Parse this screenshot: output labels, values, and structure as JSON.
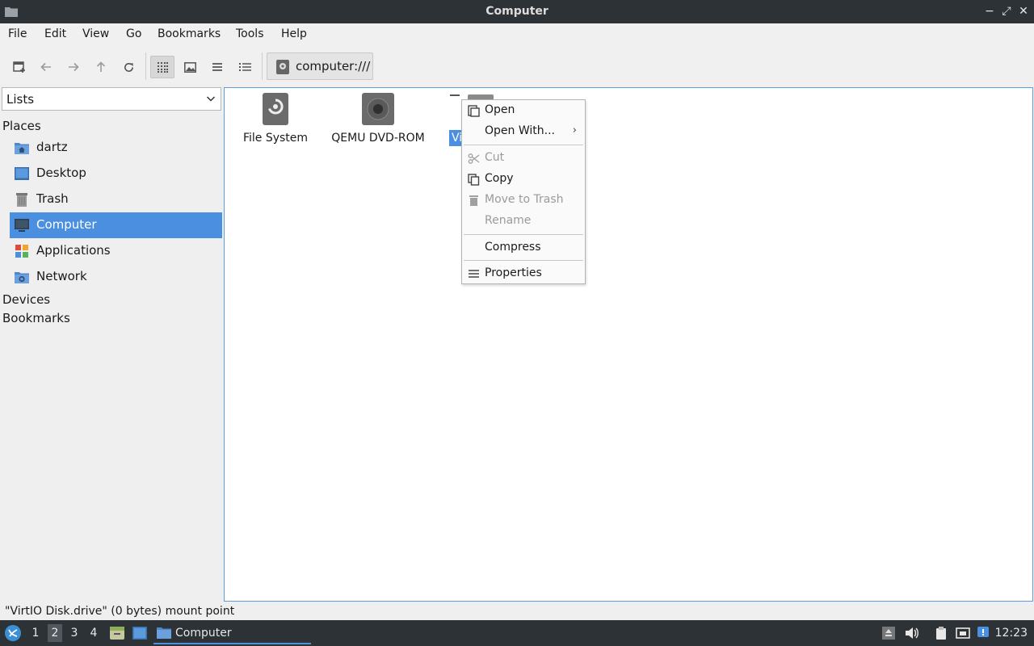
{
  "window": {
    "title": "Computer"
  },
  "window_controls": {
    "minimize": "−",
    "maximize": "⤢",
    "close": "✕"
  },
  "menu": {
    "file": "File",
    "edit": "Edit",
    "view": "View",
    "go": "Go",
    "bookmarks": "Bookmarks",
    "tools": "Tools",
    "help": "Help"
  },
  "path": {
    "value": "computer:///"
  },
  "sidebar": {
    "combo_value": "Lists",
    "places_header": "Places",
    "items": [
      {
        "label": "dartz",
        "icon": "home-folder-icon"
      },
      {
        "label": "Desktop",
        "icon": "desktop-icon"
      },
      {
        "label": "Trash",
        "icon": "trash-icon"
      },
      {
        "label": "Computer",
        "icon": "computer-icon"
      },
      {
        "label": "Applications",
        "icon": "applications-icon"
      },
      {
        "label": "Network",
        "icon": "network-icon"
      }
    ],
    "devices_header": "Devices",
    "bookmarks_header": "Bookmarks"
  },
  "files": {
    "items": [
      {
        "label": "File System",
        "icon": "harddisk-icon"
      },
      {
        "label": "QEMU DVD-ROM",
        "icon": "optical-drive-icon"
      }
    ],
    "selected_partial_label": "Vi"
  },
  "context_menu": {
    "open": "Open",
    "open_with": "Open With...",
    "submenu_arrow": "›",
    "cut": "Cut",
    "copy": "Copy",
    "move_to_trash": "Move to Trash",
    "rename": "Rename",
    "compress": "Compress",
    "properties": "Properties"
  },
  "status": {
    "text": "\"VirtIO Disk.drive\" (0 bytes) mount point"
  },
  "taskbar": {
    "workspaces": [
      "1",
      "2",
      "3",
      "4"
    ],
    "active_workspace": "2",
    "window_label": "Computer",
    "clock": "12:23"
  },
  "colors": {
    "accent": "#4a8fe0",
    "titlebar": "#2d3237"
  }
}
